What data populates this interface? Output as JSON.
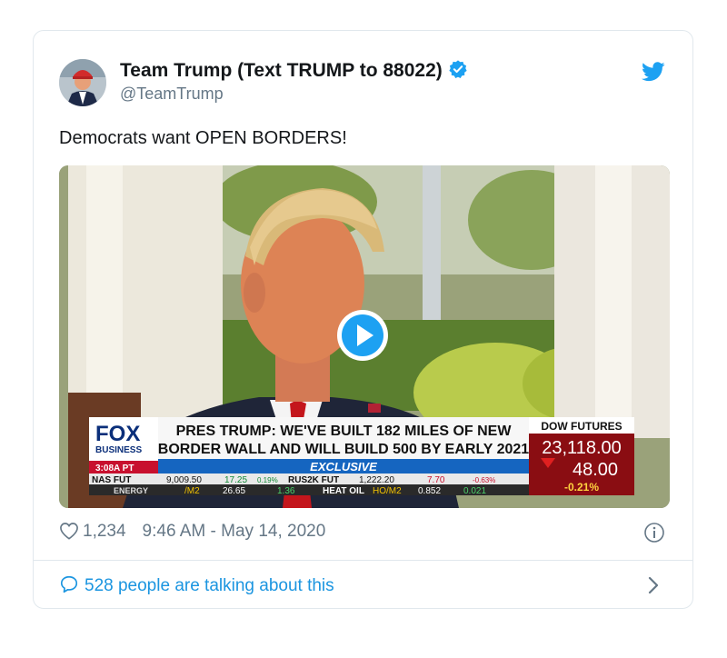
{
  "tweet": {
    "display_name": "Team Trump (Text TRUMP to 88022)",
    "handle": "@TeamTrump",
    "text": "Democrats want OPEN BORDERS!",
    "likes": "1,234",
    "timestamp": "9:46 AM - May 14, 2020",
    "conversation_label": "528 people are talking about this"
  },
  "video": {
    "network_logo": "FOX",
    "network_sub": "BUSINESS",
    "time": "3:08A PT",
    "headline_line1": "PRES TRUMP: WE'VE BUILT 182 MILES OF NEW",
    "headline_line2": "BORDER WALL AND WILL BUILD 500 BY EARLY 2021",
    "exclusive": "EXCLUSIVE",
    "dow_title": "DOW FUTURES",
    "dow_value": "23,118.00",
    "dow_change": "48.00",
    "dow_pct": "-0.21%",
    "ticker_row1_label": "NAS FUT",
    "ticker_row1_a": "9,009.50",
    "ticker_row1_b": "17.25",
    "ticker_row1_c": "0.19%",
    "ticker_row1_d": "RUS2K FUT",
    "ticker_row1_e": "1,222.20",
    "ticker_row1_f": "7.70",
    "ticker_row1_g": "-0.63%",
    "ticker_row2_label": "ENERGY",
    "ticker_row2_a": "/M2",
    "ticker_row2_b": "26.65",
    "ticker_row2_c": "1.36",
    "ticker_row2_d": "HEAT OIL",
    "ticker_row2_e": "HO/M2",
    "ticker_row2_f": "0.852",
    "ticker_row2_g": "0.021"
  },
  "icons": {
    "verified": "verified-badge-icon",
    "bird": "twitter-bird-icon",
    "heart": "heart-icon",
    "info": "info-icon",
    "bubble": "speech-bubble-icon",
    "chevron": "chevron-right-icon",
    "play": "play-icon"
  },
  "colors": {
    "accent": "#1da1f2",
    "link": "#1b95e0",
    "muted": "#657786"
  }
}
